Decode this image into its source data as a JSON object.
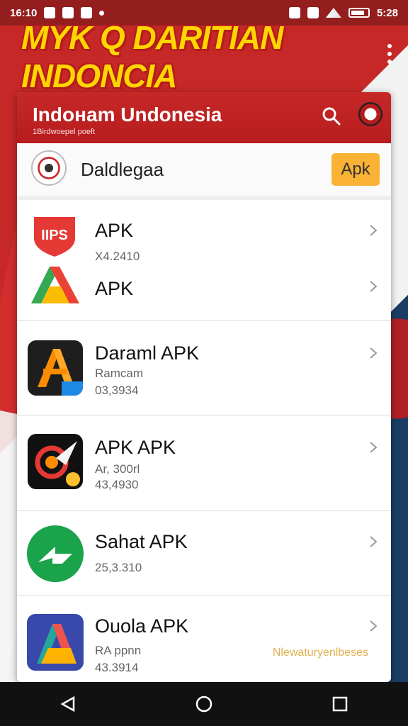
{
  "status_bar": {
    "time_left": "16:10",
    "time_right": "5:28"
  },
  "banner": {
    "title": "MYK Q DARITIAN INDONCIA"
  },
  "header": {
    "title": "Indoнam Undonesia",
    "subtitle": "1Birdwoepel poeft"
  },
  "sub_header": {
    "name": "Daldlegaa",
    "button_label": "Apk"
  },
  "apps": [
    {
      "title": "APK",
      "meta1": "X4.2410",
      "meta2": "",
      "icon": "aps-shield-icon"
    },
    {
      "title": "APK",
      "meta1": "",
      "meta2": "",
      "icon": "color-a-icon"
    },
    {
      "title": "Daraml APK",
      "meta1": "Ramcam",
      "meta2": "03,3934",
      "icon": "orange-a-icon"
    },
    {
      "title": "APK APK",
      "meta1": "Ar, 300rl",
      "meta2": "43,4930",
      "icon": "rocket-icon"
    },
    {
      "title": "Sahat APK",
      "meta1": "25,3.310",
      "meta2": "",
      "icon": "green-arrow-icon"
    },
    {
      "title": "Ouola APK",
      "meta1": "RA ppnn",
      "meta2": "43.3914",
      "icon": "triangle-play-icon"
    }
  ],
  "watermark": "Nlewaturyenlbeses",
  "colors": {
    "header_red": "#c62828",
    "banner_yellow": "#ffd600",
    "apk_button": "#f9b233"
  }
}
